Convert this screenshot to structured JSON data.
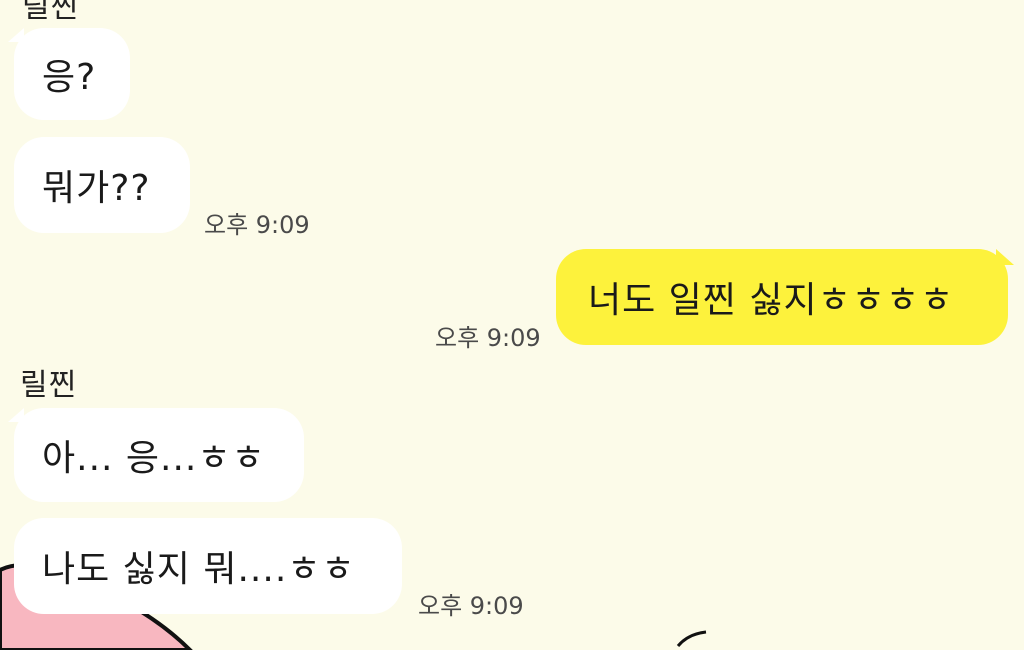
{
  "chat": {
    "sender_name_top": "릴찐",
    "sender_name": "릴찐",
    "messages": [
      {
        "text": "응?",
        "from": "other"
      },
      {
        "text": "뭐가??",
        "from": "other",
        "time": "오후 9:09"
      },
      {
        "text": "너도 일찐 싫지ㅎㅎㅎㅎ",
        "from": "me",
        "time": "오후 9:09"
      },
      {
        "text": "아... 응...ㅎㅎ",
        "from": "other"
      },
      {
        "text": "나도 싫지 뭐....ㅎㅎ",
        "from": "other",
        "time": "오후 9:09"
      }
    ]
  },
  "colors": {
    "background": "#fcfbe9",
    "bubble_other": "#ffffff",
    "bubble_me": "#fdf23c"
  }
}
